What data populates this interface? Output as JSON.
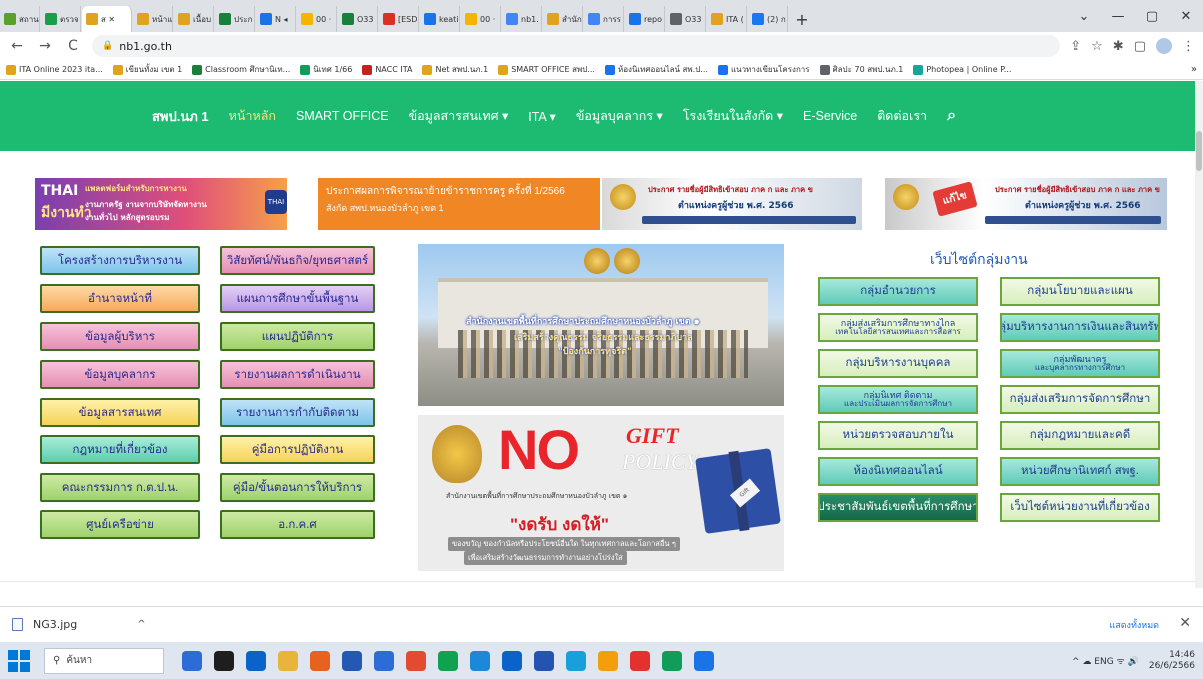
{
  "browser": {
    "tabs": [
      {
        "label": "สถาน",
        "color": "#5aa02c"
      },
      {
        "label": "ตรวจ",
        "color": "#1b9e4a"
      },
      {
        "label": "ส ✕",
        "color": "#e0a31f",
        "active": true
      },
      {
        "label": "หน้าแ",
        "color": "#e0a31f"
      },
      {
        "label": "เนื้อบ",
        "color": "#e0a31f"
      },
      {
        "label": "ประก",
        "color": "#188038"
      },
      {
        "label": "N ◂",
        "color": "#1a73e8"
      },
      {
        "label": "00 ·",
        "color": "#f4b400"
      },
      {
        "label": "O33",
        "color": "#188038"
      },
      {
        "label": "[ESD",
        "color": "#d93025"
      },
      {
        "label": "keati",
        "color": "#1a73e8"
      },
      {
        "label": "00 ·",
        "color": "#f4b400"
      },
      {
        "label": "nb1.",
        "color": "#4285f4"
      },
      {
        "label": "สำนัก",
        "color": "#e0a31f"
      },
      {
        "label": "การร",
        "color": "#4285f4"
      },
      {
        "label": "repo",
        "color": "#1a73e8"
      },
      {
        "label": "O33",
        "color": "#5f6368"
      },
      {
        "label": "ITA (",
        "color": "#e0a31f"
      },
      {
        "label": "(2) ก",
        "color": "#1877f2"
      }
    ],
    "new_tab": "+",
    "window_controls": [
      "⌄",
      "—",
      "▢",
      "✕"
    ],
    "nav": {
      "back": "←",
      "forward": "→",
      "reload": "C"
    },
    "address": "nb1.go.th",
    "lock": "🔒",
    "toolbar_icons": [
      "⇪",
      "☆",
      "✱",
      "▢"
    ],
    "bookmarks": [
      {
        "label": "ITA Online 2023 ita...",
        "color": "#e0a31f"
      },
      {
        "label": "เขียนทั้งม เขต 1",
        "color": "#e0a31f"
      },
      {
        "label": "Classroom ศึกษานิเท...",
        "color": "#188038"
      },
      {
        "label": "นิเทศ 1/66",
        "color": "#0f9d58"
      },
      {
        "label": "NACC ITA",
        "color": "#c5221f"
      },
      {
        "label": "Net สพป.นภ.1",
        "color": "#e0a31f"
      },
      {
        "label": "SMART OFFICE สพป...",
        "color": "#e0a31f"
      },
      {
        "label": "ห้องนิเทศออนไลน์ สพ.ป...",
        "color": "#1a73e8"
      },
      {
        "label": "แนวทางเขียนโครงการ",
        "color": "#1a73e8"
      },
      {
        "label": "ศิลปะ 70 สพป.นภ.1",
        "color": "#5f6368"
      },
      {
        "label": "Photopea | Online P...",
        "color": "#18a497"
      }
    ],
    "bookmarks_more": "»"
  },
  "site": {
    "nav": {
      "brand": "สพป.นภ 1",
      "items": [
        {
          "label": "หน้าหลัก",
          "current": true
        },
        {
          "label": "SMART OFFICE"
        },
        {
          "label": "ข้อมูลสารสนเทศ ▾"
        },
        {
          "label": "ITA ▾"
        },
        {
          "label": "ข้อมูลบุคลากร ▾"
        },
        {
          "label": "โรงเรียนในสังกัด ▾"
        },
        {
          "label": "E-Service"
        },
        {
          "label": "ติดต่อเรา"
        }
      ],
      "search_icon": "⌕",
      "color": "#1dbb72"
    },
    "banners": {
      "b1": {
        "title": "THAI",
        "sub": "มีงานทำ",
        "line1": "แพลตฟอร์มสำหรับการหางาน",
        "line2": "งานภาครัฐ   งานจากบริษัทจัดหางาน",
        "line3": "งานทั่วไป     หลักสูตรอบรม",
        "logo": "THAI"
      },
      "b2": {
        "line1": "ประกาศผลการพิจารณาย้ายข้าราชการครู ครั้งที่ 1/2566",
        "line2": "สังกัด สพป.หนองบัวลำภู เขต 1"
      },
      "b3": {
        "line1": "ประกาศ รายชื่อผู้มีสิทธิเข้าสอบ ภาค ก และ ภาค ข",
        "line2": "ตำแหน่งครูผู้ช่วย พ.ศ. 2566"
      },
      "b4": {
        "mega": "แก้ไข",
        "line1": "ประกาศ รายชื่อผู้มีสิทธิเข้าสอบ ภาค ก และ ภาค ข",
        "line2": "ตำแหน่งครูผู้ช่วย พ.ศ. 2566"
      }
    },
    "left_menu": {
      "col1": [
        {
          "label": "โครงสร้างการบริหารงาน",
          "style": "blue"
        },
        {
          "label": "อำนาจหน้าที่",
          "style": "orange"
        },
        {
          "label": "ข้อมูลผู้บริหาร",
          "style": "pink"
        },
        {
          "label": "ข้อมูลบุคลากร",
          "style": "pink"
        },
        {
          "label": "ข้อมูลสารสนเทศ",
          "style": "yellow"
        },
        {
          "label": "กฎหมายที่เกี่ยวข้อง",
          "style": "teal"
        },
        {
          "label": "คณะกรรมการ ก.ต.ป.น.",
          "style": "green"
        },
        {
          "label": "ศูนย์เครือข่าย",
          "style": "green"
        }
      ],
      "col2": [
        {
          "label": "วิสัยทัศน์/พันธกิจ/ยุทธศาสตร์",
          "style": "pink"
        },
        {
          "label": "แผนการศึกษาขั้นพื้นฐาน",
          "style": "purple"
        },
        {
          "label": "แผนปฏิบัติการ",
          "style": "green"
        },
        {
          "label": "รายงานผลการดำเนินงาน",
          "style": "pink"
        },
        {
          "label": "รายงานการกำกับติดตาม",
          "style": "blue"
        },
        {
          "label": "คู่มือการปฏิบัติงาน",
          "style": "yellow"
        },
        {
          "label": "คู่มือ/ขั้นตอนการให้บริการ",
          "style": "green"
        },
        {
          "label": "อ.ก.ค.ศ",
          "style": "green"
        }
      ]
    },
    "photo": {
      "line1": "สำนักงานเขตพื้นที่การศึกษาประถมศึกษาหนองบัวลำภู เขต ๑",
      "line2": "เสริมสร้างคุณธรรม จริยธรรมและธรรมาภิบาล",
      "line3": "\"ป้องกันการทุจริต\""
    },
    "gift": {
      "no": "NO",
      "gift": "GIFT",
      "policy": "POLICY",
      "org": "สำนักงานเขตพื้นที่การศึกษาประถมศึกษาหนองบัวลำภู เขต ๑",
      "slogan": "\"งดรับ งดให้\"",
      "line1": "ของขวัญ ของกำนัลหรือประโยชน์อื่นใด ในทุกเทศกาลและโอกาสอื่น ๆ",
      "line2": "เพื่อเสริมสร้างวัฒนธรรมการทำงานอย่างโปร่งใส",
      "tag": "Gift"
    },
    "groups": {
      "title": "เว็บไซต์กลุ่มงาน",
      "col1": [
        {
          "label": "กลุ่มอำนวยการ",
          "style": "fill"
        },
        {
          "label": "กลุ่มส่งเสริมการศึกษาทางไกล",
          "small": "เทคโนโลยีสารสนเทศและการสื่อสาร",
          "style": "plain"
        },
        {
          "label": "กลุ่มบริหารงานบุคคล",
          "style": "plain"
        },
        {
          "label": "กลุ่มนิเทศ ติดตาม",
          "small": "และประเมินผลการจัดการศึกษา",
          "style": "fill"
        },
        {
          "label": "หน่วยตรวจสอบภายใน",
          "style": "plain"
        },
        {
          "label": "ห้องนิเทศออนไลน์",
          "style": "fill"
        },
        {
          "label": "ประชาสัมพันธ์เขตพื้นที่การศึกษา",
          "style": "dark"
        }
      ],
      "col2": [
        {
          "label": "กลุ่มนโยบายและแผน",
          "style": "plain"
        },
        {
          "label": "กลุ่มบริหารงานการเงินและสินทรัพย์",
          "style": "fill"
        },
        {
          "label": "กลุ่มพัฒนาครู",
          "small": "และบุคลากรทางการศึกษา",
          "style": "fill"
        },
        {
          "label": "กลุ่มส่งเสริมการจัดการศึกษา",
          "style": "plain"
        },
        {
          "label": "กลุ่มกฎหมายและคดี",
          "style": "plain"
        },
        {
          "label": "หน่วยศึกษานิเทศก์ สพฐ.",
          "style": "fill"
        },
        {
          "label": "เว็บไซต์หน่วยงานที่เกี่ยวข้อง",
          "style": "plain"
        }
      ]
    }
  },
  "download": {
    "file": "NG3.jpg",
    "caret": "^",
    "show_all": "แสดงทั้งหมด",
    "close": "✕"
  },
  "taskbar": {
    "search": "ค้นหา",
    "apps": [
      "#2b6cd6",
      "#1e1e1e",
      "#0a63c9",
      "#e8b43a",
      "#e8621f",
      "#2359b3",
      "#2b6cd6",
      "#e34a2f",
      "#10a24f",
      "#1b88d8",
      "#0a63c9",
      "#2354b0",
      "#18a0db",
      "#f59e0b",
      "#e5312b",
      "#0f9d58",
      "#1a73e8"
    ],
    "tray": "^  ☁  ENG  ᯤ  🔊",
    "time": "14:46",
    "date": "26/6/2566"
  }
}
